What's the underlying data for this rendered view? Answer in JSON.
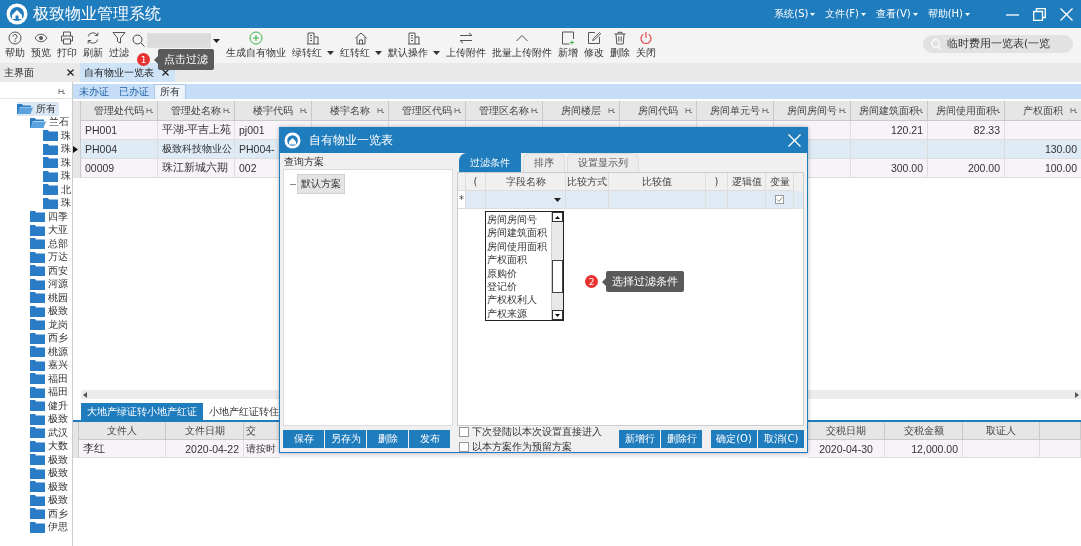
{
  "app": {
    "title": "极致物业管理系统",
    "menus": [
      "系统(S)",
      "文件(F)",
      "查看(V)",
      "帮助(H)"
    ]
  },
  "toolbar": {
    "items": [
      {
        "kind": "button",
        "label": "帮助",
        "has_menu": false
      },
      {
        "kind": "button",
        "label": "预览",
        "has_menu": false
      },
      {
        "kind": "button",
        "label": "打印",
        "has_menu": false
      },
      {
        "kind": "button",
        "label": "刷新",
        "has_menu": false
      },
      {
        "kind": "button",
        "label": "过滤",
        "has_menu": false
      },
      {
        "kind": "combo"
      },
      {
        "kind": "button",
        "label": "生成自有物业",
        "has_menu": false
      },
      {
        "kind": "button",
        "label": "绿转红",
        "has_menu": true
      },
      {
        "kind": "button",
        "label": "红转红",
        "has_menu": true
      },
      {
        "kind": "button",
        "label": "默认操作",
        "has_menu": true
      },
      {
        "kind": "button",
        "label": "上传附件",
        "has_menu": false
      },
      {
        "kind": "button",
        "label": "批量上传附件",
        "has_menu": false
      },
      {
        "kind": "button",
        "label": "新增",
        "has_menu": false
      },
      {
        "kind": "button",
        "label": "修改",
        "has_menu": false
      },
      {
        "kind": "button",
        "label": "删除",
        "has_menu": false
      },
      {
        "kind": "button",
        "label": "关闭",
        "has_menu": false
      }
    ],
    "quick_search": {
      "value": "临时费用一览表(一览"
    }
  },
  "tips": [
    {
      "badge": "1",
      "text": "点击过滤"
    },
    {
      "badge": "2",
      "text": "选择过滤条件"
    }
  ],
  "doc_tabs": [
    {
      "label": "主界面",
      "selected": false
    },
    {
      "label": "自有物业一览表",
      "selected": true
    }
  ],
  "tree": [
    {
      "label": "所有",
      "selected": true,
      "children": [
        {
          "label": "兰石",
          "selected": false,
          "children": [
            {
              "label": "珠",
              "selected": false
            },
            {
              "label": "珠",
              "selected": false
            },
            {
              "label": "珠",
              "selected": false
            },
            {
              "label": "珠",
              "selected": false
            },
            {
              "label": "北",
              "selected": false
            },
            {
              "label": "珠",
              "selected": false
            }
          ]
        },
        {
          "label": "四季",
          "selected": false
        },
        {
          "label": "大亚",
          "selected": false
        },
        {
          "label": "总部",
          "selected": false
        },
        {
          "label": "万达",
          "selected": false
        },
        {
          "label": "西安",
          "selected": false
        },
        {
          "label": "河源",
          "selected": false
        },
        {
          "label": "桃园",
          "selected": false
        },
        {
          "label": "极致",
          "selected": false
        },
        {
          "label": "龙岗",
          "selected": false
        },
        {
          "label": "西乡",
          "selected": false
        },
        {
          "label": "桃源",
          "selected": false
        },
        {
          "label": "嘉兴",
          "selected": false
        },
        {
          "label": "福田",
          "selected": false
        },
        {
          "label": "福田",
          "selected": false
        },
        {
          "label": "健升",
          "selected": false
        },
        {
          "label": "极致",
          "selected": false
        },
        {
          "label": "武汉",
          "selected": false
        },
        {
          "label": "大数",
          "selected": false
        },
        {
          "label": "极致",
          "selected": false
        },
        {
          "label": "极致",
          "selected": false
        },
        {
          "label": "极致",
          "selected": false
        },
        {
          "label": "极致",
          "selected": false
        },
        {
          "label": "西乡",
          "selected": false
        },
        {
          "label": "伊思",
          "selected": false
        }
      ]
    }
  ],
  "status_tabs": [
    {
      "label": "未办证",
      "selected": false
    },
    {
      "label": "已办证",
      "selected": false
    },
    {
      "label": "所有",
      "selected": true
    }
  ],
  "table": {
    "columns": [
      {
        "label": "管理处代码",
        "kind": "text"
      },
      {
        "label": "管理处名称",
        "kind": "text"
      },
      {
        "label": "楼宇代码",
        "kind": "text"
      },
      {
        "label": "楼宇名称",
        "kind": "text"
      },
      {
        "label": "管理区代码",
        "kind": "text"
      },
      {
        "label": "管理区名称",
        "kind": "text"
      },
      {
        "label": "房间楼层",
        "kind": "text"
      },
      {
        "label": "房间代码",
        "kind": "text"
      },
      {
        "label": "房间单元号",
        "kind": "text"
      },
      {
        "label": "房间房间号",
        "kind": "text"
      },
      {
        "label": "房间建筑面积",
        "kind": "number"
      },
      {
        "label": "房间使用面积",
        "kind": "number"
      },
      {
        "label": "产权面积",
        "kind": "number"
      }
    ],
    "rows": [
      {
        "selected": false,
        "cells": [
          "PH001",
          "平湖-平吉上苑",
          "pj001",
          null,
          null,
          null,
          null,
          null,
          null,
          null,
          "120.21",
          "82.33",
          null
        ]
      },
      {
        "selected": true,
        "cells": [
          "PH004",
          "极致科技物业公",
          "PH004-",
          null,
          null,
          null,
          null,
          null,
          null,
          null,
          null,
          null,
          "130.00"
        ]
      },
      {
        "selected": false,
        "cells": [
          "00009",
          "珠江新城六期",
          "002",
          null,
          null,
          null,
          null,
          null,
          null,
          null,
          "300.00",
          "200.00",
          "100.00"
        ]
      }
    ]
  },
  "sub_tabs": [
    {
      "label": "大地产绿证转小地产红证",
      "selected": true
    },
    {
      "label": "小地产红证转住",
      "selected": false
    }
  ],
  "sub_table": {
    "columns": [
      {
        "label": "文件人",
        "kind": "text"
      },
      {
        "label": "文件日期",
        "kind": "number"
      },
      {
        "label": "交",
        "kind": "text"
      },
      {
        "label": "交税日期",
        "kind": "date"
      },
      {
        "label": "交税金额",
        "kind": "number"
      },
      {
        "label": "取证人",
        "kind": "text"
      }
    ],
    "rows": [
      {
        "cells": [
          "李红",
          "2020-04-22",
          "请按时",
          "2020-04-30",
          "12,000.00",
          null
        ]
      }
    ]
  },
  "dialog": {
    "title": "自有物业一览表",
    "scheme_label": "查询方案",
    "schemes": [
      {
        "label": "默认方案",
        "selected": true
      }
    ],
    "tabs": [
      {
        "label": "过滤条件",
        "selected": true
      },
      {
        "label": "排序",
        "selected": false
      },
      {
        "label": "设置显示列",
        "selected": false
      }
    ],
    "grid": {
      "columns": [
        "(",
        "字段名称",
        "比较方式",
        "比较值",
        ")",
        "逻辑值",
        "变量"
      ],
      "new_row": {
        "marker": "*",
        "variable_checked": true
      }
    },
    "field_options": [
      "房间房间号",
      "房间建筑面积",
      "房间使用面积",
      "产权面积",
      "原购价",
      "登记价",
      "产权权利人",
      "产权来源"
    ],
    "scheme_buttons": [
      "保存",
      "另存为",
      "删除",
      "发布"
    ],
    "options": [
      {
        "label": "下次登陆以本次设置直接进入",
        "checked": false
      },
      {
        "label": "以本方案作为预留方案",
        "checked": false
      }
    ],
    "row_buttons": [
      "新增行",
      "删除行"
    ],
    "buttons": [
      "确定(O)",
      "取消(C)"
    ]
  }
}
